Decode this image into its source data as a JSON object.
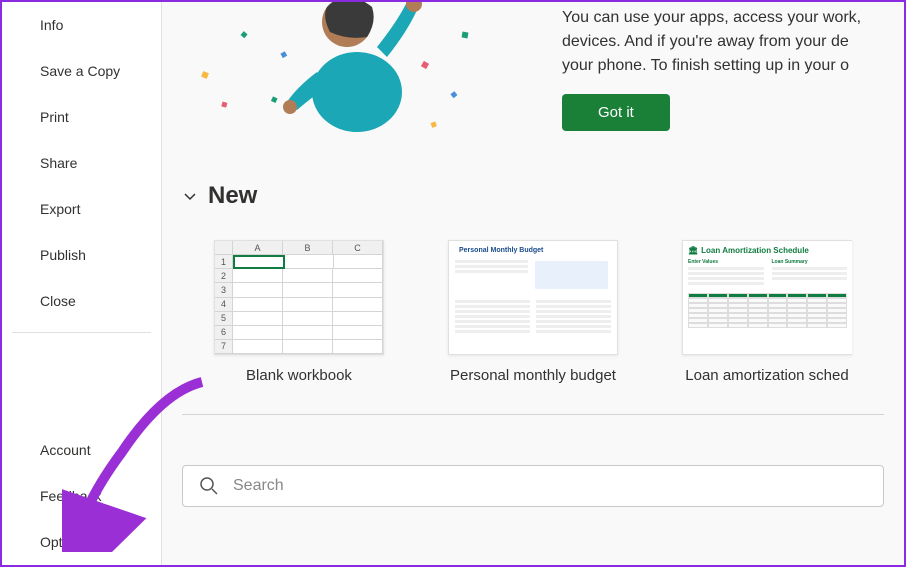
{
  "sidebar": {
    "top_items": [
      {
        "label": "Info"
      },
      {
        "label": "Save a Copy"
      },
      {
        "label": "Print"
      },
      {
        "label": "Share"
      },
      {
        "label": "Export"
      },
      {
        "label": "Publish"
      },
      {
        "label": "Close"
      }
    ],
    "bottom_items": [
      {
        "label": "Account"
      },
      {
        "label": "Feedback"
      },
      {
        "label": "Options"
      }
    ]
  },
  "hero": {
    "text": "You can use your apps, access your work, devices. And if you're away from your de your phone. To finish setting up in your o",
    "button_label": "Got it"
  },
  "new_section": {
    "title": "New",
    "templates": [
      {
        "label": "Blank workbook"
      },
      {
        "label": "Personal monthly budget",
        "thumb_title": "Personal Monthly Budget"
      },
      {
        "label": "Loan amortization sched",
        "thumb_title": "Loan Amortization Schedule",
        "col1": "Enter Values",
        "col2": "Loan Summary"
      }
    ]
  },
  "search": {
    "placeholder": "Search"
  },
  "spreadsheet_preview": {
    "columns": [
      "A",
      "B",
      "C"
    ],
    "rows": [
      "1",
      "2",
      "3",
      "4",
      "5",
      "6",
      "7"
    ],
    "selected_cell": "A1"
  }
}
